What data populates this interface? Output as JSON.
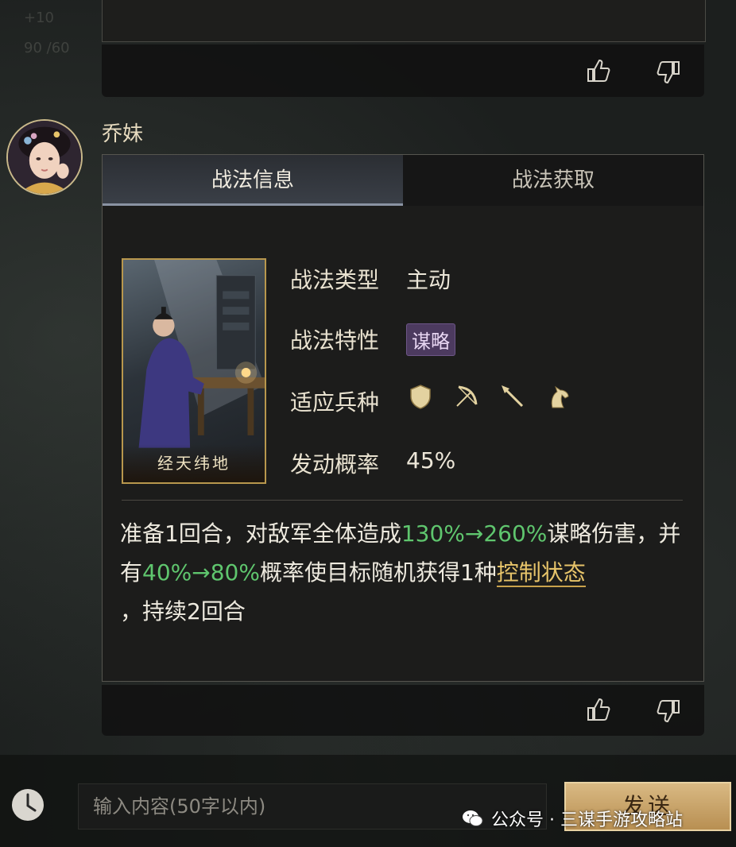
{
  "previous_message": {
    "ghost_text": "+10",
    "ghost_text_2": "90 /60"
  },
  "message": {
    "user_name": "乔妹",
    "tabs": [
      {
        "label": "战法信息",
        "active": true
      },
      {
        "label": "战法获取",
        "active": false
      }
    ],
    "tactic": {
      "image_title": "经天纬地",
      "type_label": "战法类型",
      "type_value": "主动",
      "trait_label": "战法特性",
      "trait_value": "谋略",
      "troop_label": "适应兵种",
      "troop_icons": [
        "shield-icon",
        "bow-icon",
        "spear-icon",
        "horse-icon"
      ],
      "rate_label": "发动概率",
      "rate_value": "45%"
    },
    "description": {
      "p1": "准备1回合，对敌军全体造成",
      "g1": "130%→260%",
      "p2": "谋略伤害，并有",
      "g2": "40%→80%",
      "p3": "概率使目标随机获得1种",
      "link": "控制状态",
      "p4": "，持续2回合"
    }
  },
  "input": {
    "placeholder": "输入内容(50字以内)",
    "send_label": "发送"
  },
  "watermark": "公众号 · 三谋手游攻略站",
  "colors": {
    "highlight_green": "#5fc66e",
    "link_gold": "#e7c46a",
    "trait_purple": "#4c3a5f"
  }
}
